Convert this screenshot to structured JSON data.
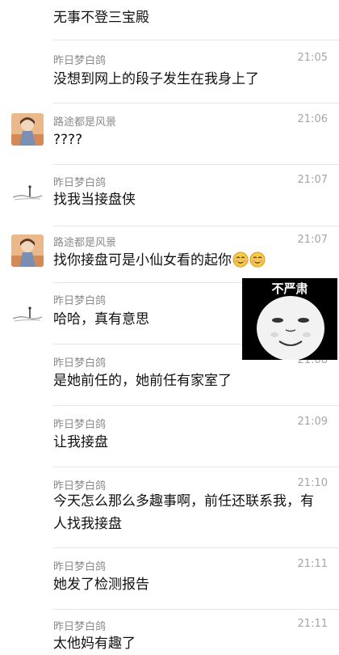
{
  "messages": [
    {
      "name": "",
      "time": "",
      "text": "无事不登三宝殿",
      "avatar": "none"
    },
    {
      "name": "昨日梦白鸽",
      "time": "21:05",
      "text": "没想到网上的段子发生在我身上了",
      "avatar": "none"
    },
    {
      "name": "路途都是风景",
      "time": "21:06",
      "text": "????",
      "avatar": "girl-avatar-icon"
    },
    {
      "name": "昨日梦白鸽",
      "time": "21:07",
      "text": "找我当接盘侠",
      "avatar": "ink-landscape-avatar-icon"
    },
    {
      "name": "路途都是风景",
      "time": "21:07",
      "text": "找你接盘可是小仙女看的起你",
      "avatar": "girl-avatar-icon",
      "emojis": [
        "blush-emoji-icon",
        "blush-emoji-icon"
      ]
    },
    {
      "name": "昨日梦白鸽",
      "time": "",
      "text": "哈哈，真有意思",
      "avatar": "ink-landscape-avatar-icon"
    },
    {
      "name": "昨日梦白鸽",
      "time": "21:08",
      "text": "是她前任的，她前任有家室了",
      "avatar": "none"
    },
    {
      "name": "昨日梦白鸽",
      "time": "21:09",
      "text": "让我接盘",
      "avatar": "none"
    },
    {
      "name": "昨日梦白鸽",
      "time": "21:10",
      "text": "今天怎么那么多趣事啊，前任还联系我，有人找我接盘",
      "avatar": "none"
    },
    {
      "name": "昨日梦白鸽",
      "time": "21:11",
      "text": "她发了检测报告",
      "avatar": "none"
    },
    {
      "name": "昨日梦白鸽",
      "time": "21:11",
      "text": "太他妈有趣了",
      "avatar": "none"
    }
  ],
  "sticker": {
    "caption": "不严肃",
    "icon": "panda-face-meme-icon"
  }
}
